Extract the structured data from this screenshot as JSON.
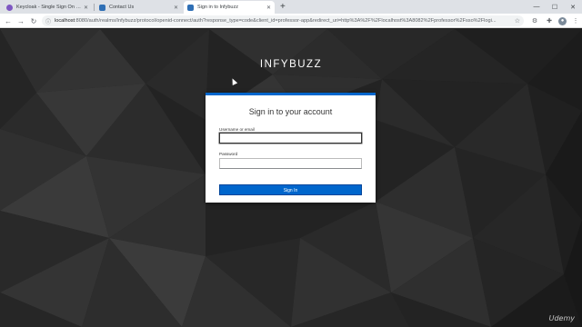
{
  "tabs": [
    {
      "title": "Keycloak - Single Sign On with S",
      "favicon_color": "#7e57c2"
    },
    {
      "title": "Contact Us",
      "favicon_color": "#2f6fb5"
    },
    {
      "title": "Sign in to Infybuzz",
      "favicon_color": "#2f6fb5"
    }
  ],
  "new_tab_symbol": "+",
  "address": {
    "host": "localhost",
    "rest": ":8080/auth/realms/Infybuzz/protocol/openid-connect/auth?response_type=code&client_id=professor-app&redirect_uri=http%3A%2F%2Flocalhost%3A8082%2Fprofessor%2Fsso%2Flogi..."
  },
  "page": {
    "brand": "INFYBUZZ",
    "card_title": "Sign in to your account",
    "username_label": "Username or email",
    "username_value": "",
    "password_label": "Password",
    "password_value": "",
    "submit_label": "Sign In",
    "accent": "#0066cc"
  },
  "watermark": "Udemy"
}
